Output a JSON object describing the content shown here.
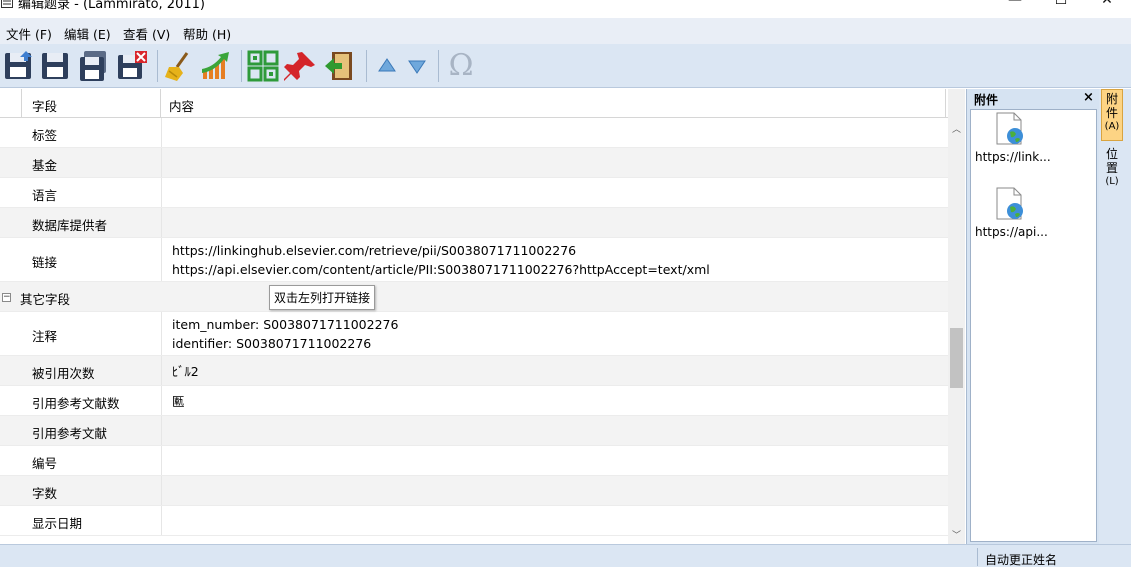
{
  "window": {
    "title": "编辑题录 - (Lammirato, 2011)",
    "controls": {
      "minimize": "—",
      "maximize": "☐",
      "close": "✕"
    }
  },
  "menu": [
    {
      "label": "文件 (F)"
    },
    {
      "label": "编辑 (E)"
    },
    {
      "label": "查看 (V)"
    },
    {
      "label": "帮助 (H)"
    }
  ],
  "toolbar": {
    "icons": [
      "save-icon",
      "save-icon",
      "save-as-icon",
      "save-close-icon",
      "clean-broom-icon",
      "trend-chart-icon",
      "qr-grid-icon",
      "pin-icon",
      "exit-door-icon",
      "arrow-up-icon",
      "arrow-down-icon",
      "omega-icon"
    ],
    "omega_glyph": "Ω"
  },
  "grid": {
    "columns": {
      "field": "字段",
      "content": "内容"
    },
    "rows": [
      {
        "field": "标签",
        "content": []
      },
      {
        "field": "基金",
        "content": []
      },
      {
        "field": "语言",
        "content": []
      },
      {
        "field": "数据库提供者",
        "content": []
      },
      {
        "field": "链接",
        "content": [
          "https://linkinghub.elsevier.com/retrieve/pii/S0038071711002276",
          "https://api.elsevier.com/content/article/PII:S0038071711002276?httpAccept=text/xml"
        ]
      },
      {
        "field": "其它字段",
        "group": true,
        "toggle": "−",
        "content": []
      },
      {
        "field": "注释",
        "content": [
          "item_number: S0038071711002276",
          "identifier: S0038071711002276"
        ]
      },
      {
        "field": "被引用次数",
        "content": [
          "ﾋﾞﾙ2"
        ]
      },
      {
        "field": "引用参考文献数",
        "content": [
          "匭"
        ]
      },
      {
        "field": "引用参考文献",
        "content": []
      },
      {
        "field": "编号",
        "content": []
      },
      {
        "field": "字数",
        "content": []
      },
      {
        "field": "显示日期",
        "content": []
      }
    ],
    "tooltip": "双击左列打开链接"
  },
  "attachments": {
    "title": "附件",
    "close": "×",
    "items": [
      {
        "name": "https://link..."
      },
      {
        "name": "https://api..."
      }
    ]
  },
  "side_tabs": [
    {
      "label": "附件",
      "key": "(A)",
      "active": true
    },
    {
      "label": "位置",
      "key": "(L)",
      "active": false
    }
  ],
  "status": {
    "text": "自动更正姓名"
  },
  "colors": {
    "toolbar_bg": "#dbe6f3",
    "row_alt": "#f3f3f3",
    "tab_active": "#fdd484"
  }
}
